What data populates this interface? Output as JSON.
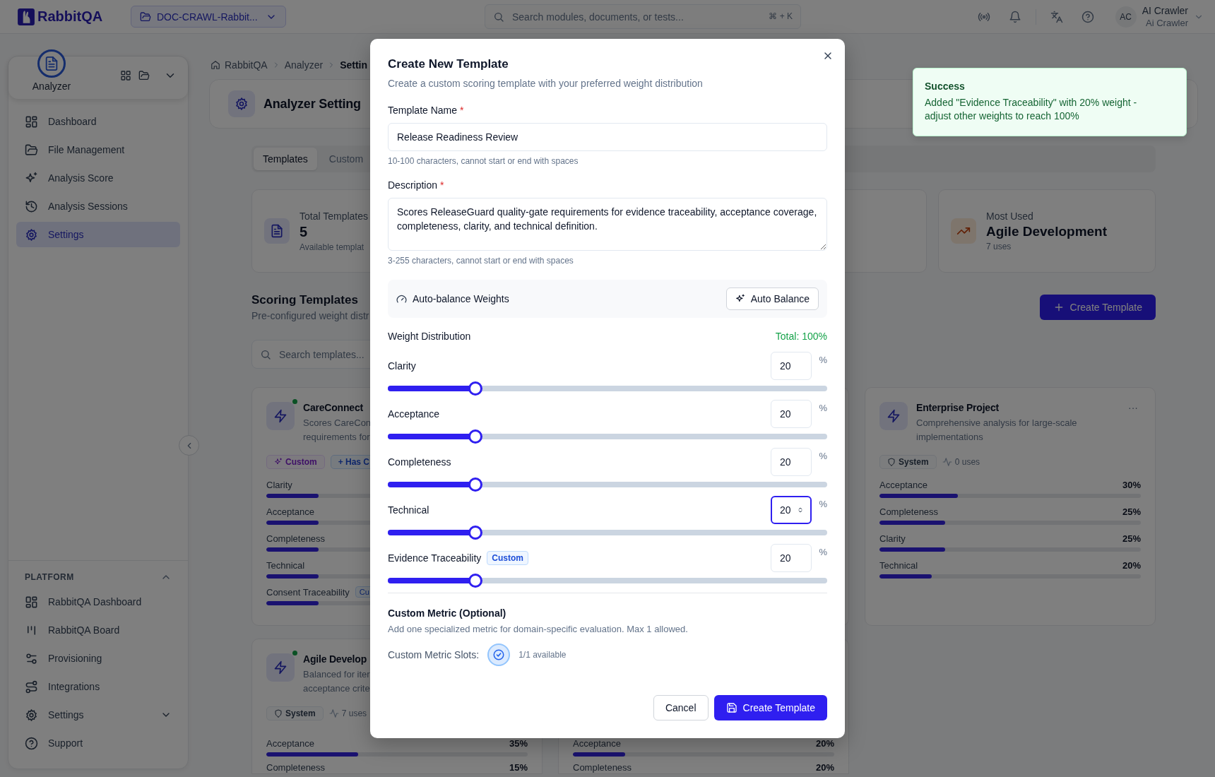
{
  "topbar": {
    "brand": "RabbitQA",
    "project": "DOC-CRAWL-Rabbit...",
    "search": {
      "placeholder": "Search modules, documents, or tests..."
    },
    "shortcut": "⌘ + K",
    "user": {
      "initials": "AC",
      "name": "AI Crawler",
      "subtitle": "Ai Crawler"
    }
  },
  "sidebar": {
    "module": "Analyzer",
    "items": [
      {
        "label": "Dashboard",
        "selected": false
      },
      {
        "label": "File Management",
        "selected": false
      },
      {
        "label": "Analysis Score",
        "selected": false
      },
      {
        "label": "Analysis Sessions",
        "selected": false
      },
      {
        "label": "Settings",
        "selected": true
      }
    ],
    "platform": {
      "title": "PLATFORM",
      "expanded": true,
      "items": [
        {
          "label": "RabbitQA Dashboard",
          "kind": "link"
        },
        {
          "label": "RabbitQA Board",
          "kind": "link"
        },
        {
          "label": "Provisioning",
          "kind": "link"
        },
        {
          "label": "Integrations",
          "kind": "link"
        },
        {
          "label": "Settings",
          "kind": "group"
        },
        {
          "label": "Support",
          "kind": "link"
        }
      ]
    }
  },
  "breadcrumb": [
    "RabbitQA",
    "Analyzer",
    "Settin"
  ],
  "page_title": "Analyzer Setting",
  "tabs": [
    {
      "label": "Templates",
      "selected": true
    },
    {
      "label": "Custom",
      "selected": false
    }
  ],
  "stats": [
    {
      "label": "Total Templates",
      "value": "5",
      "caption": "Available templat"
    },
    {
      "label": "Most Used",
      "value": "Agile Development",
      "caption": "7 uses"
    }
  ],
  "section": {
    "title": "Scoring Templates",
    "subtitle": "Pre-configured weight distr",
    "search": {
      "placeholder": "Search templates..."
    },
    "create_button": "Create Template"
  },
  "templates": [
    {
      "name": "CareConnect",
      "description": "Scores CareCon\nrequirements for",
      "active": true,
      "badges": [
        {
          "label": "Custom",
          "kind": "custom"
        },
        {
          "label": "+ Has C",
          "kind": "info"
        }
      ],
      "metrics": [
        {
          "name": "Clarity",
          "level": 0.2
        },
        {
          "name": "Acceptance",
          "level": 0.2
        },
        {
          "name": "Completeness",
          "level": 0.2
        },
        {
          "name": "Technical",
          "level": 0.2
        },
        {
          "name": "Consent Traceability",
          "badge": "Cu",
          "level": 0.2
        }
      ]
    },
    {
      "name": "Enterprise Project",
      "description": "Comprehensive analysis for large-scale\nimplementations",
      "active": false,
      "menu": "···",
      "badges": [
        {
          "label": "System",
          "kind": "system"
        }
      ],
      "uses": "0 uses",
      "metrics": [
        {
          "name": "Acceptance",
          "value": "30%",
          "level": 0.3
        },
        {
          "name": "Completeness",
          "value": "25%",
          "level": 0.25
        },
        {
          "name": "Clarity",
          "value": "25%",
          "level": 0.25
        },
        {
          "name": "Technical",
          "value": "20%",
          "level": 0.2
        }
      ]
    },
    {
      "name": "Agile Develop",
      "description": "Balanced for iter\nacceptance crite",
      "active": true,
      "badges": [
        {
          "label": "System",
          "kind": "system"
        }
      ],
      "uses": "7 uses",
      "metrics": [
        {
          "name": "Acceptance",
          "value": "35%",
          "level": 0.35
        },
        {
          "name": "Completeness",
          "value": "15%"
        }
      ]
    },
    {
      "metrics": [
        {
          "name": "Acceptance",
          "value": "20%",
          "level": 0.2
        },
        {
          "name": "Completeness",
          "value": "20%"
        }
      ]
    }
  ],
  "dialog": {
    "title": "Create New Template",
    "subtitle": "Create a custom scoring template with your preferred weight distribution",
    "fields": [
      {
        "kind": "input",
        "label": "Template Name",
        "required_mark": "*",
        "value": "Release Readiness Review",
        "hint": "10-100 characters, cannot start or end with spaces"
      },
      {
        "kind": "textarea",
        "label": "Description",
        "required_mark": "*",
        "value": "Scores ReleaseGuard quality-gate requirements for evidence traceability, acceptance coverage, completeness, clarity, and technical definition.",
        "hint": "3-255 characters, cannot start or end with spaces"
      }
    ],
    "auto_balance": {
      "label": "Auto-balance Weights",
      "button": "Auto Balance"
    },
    "weights": {
      "title": "Weight Distribution",
      "total": "Total: 100%",
      "metrics": [
        {
          "name": "Clarity",
          "value": "20",
          "unit": "%",
          "level": 0.2,
          "focused": false
        },
        {
          "name": "Acceptance",
          "value": "20",
          "unit": "%",
          "level": 0.2,
          "focused": false
        },
        {
          "name": "Completeness",
          "value": "20",
          "unit": "%",
          "level": 0.2,
          "focused": false
        },
        {
          "name": "Technical",
          "value": "20",
          "unit": "%",
          "level": 0.2,
          "focused": true
        },
        {
          "name": "Evidence Traceability",
          "badge": "Custom",
          "value": "20",
          "unit": "%",
          "level": 0.2,
          "focused": false
        }
      ]
    },
    "custom_metric": {
      "title": "Custom Metric (Optional)",
      "description": "Add one specialized metric for domain-specific evaluation. Max 1 allowed.",
      "slots_label": "Custom Metric Slots:",
      "slots_available": "1/1 available"
    },
    "buttons": [
      {
        "label": "Cancel",
        "kind": "secondary"
      },
      {
        "label": "Create Template",
        "kind": "primary"
      }
    ]
  },
  "toast": {
    "title": "Success",
    "message": "Added \"Evidence Traceability\" with 20% weight - adjust other weights to reach 100%"
  }
}
